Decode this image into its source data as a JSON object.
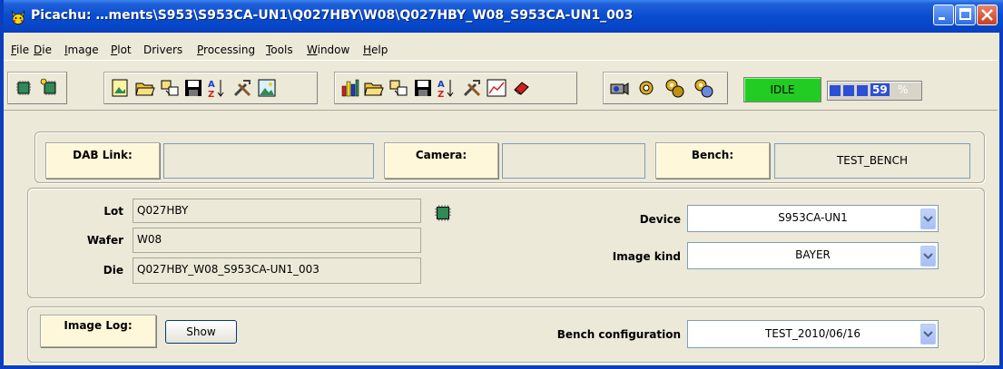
{
  "window": {
    "title": "Picachu: …ments\\S953\\S953CA-UN1\\Q027HBY\\W08\\Q027HBY_W08_S953CA-UN1_003",
    "icon": "pikachu-icon",
    "title_color": "#0A4CD0"
  },
  "menu": {
    "items": [
      {
        "accel": "F",
        "rest": "ile"
      },
      {
        "accel": "D",
        "rest": "ie"
      },
      {
        "accel": "I",
        "rest": "mage"
      },
      {
        "accel": "P",
        "rest": "lot"
      },
      {
        "accel": "D",
        "rest": "rivers",
        "prefix": ""
      },
      {
        "accel": "P",
        "rest": "rocessing"
      },
      {
        "accel": "T",
        "rest": "ools"
      },
      {
        "accel": "W",
        "rest": "indow"
      },
      {
        "accel": "H",
        "rest": "elp"
      }
    ]
  },
  "toolbar": {
    "icons": [
      "chip-icon",
      "chip-load-icon",
      "new-image-icon",
      "open-folder-icon",
      "export-icon",
      "save-icon",
      "sort-icon",
      "tools-icon",
      "image-view-icon",
      "plot-icon",
      "open-folder-icon",
      "export-icon",
      "save-icon",
      "sort-icon",
      "tools-icon",
      "line-chart-icon",
      "eraser-icon",
      "camera-icon",
      "gear-icon",
      "gears-icon",
      "gears-blue-icon"
    ]
  },
  "status": {
    "state": "IDLE",
    "state_color": "#22CC22",
    "progress_value": "59",
    "progress_unit": "%",
    "progress_fraction": 0.59
  },
  "connections": {
    "dab_label": "DAB Link:",
    "dab_value": "",
    "camera_label": "Camera:",
    "camera_value": "",
    "bench_label": "Bench:",
    "bench_value": "TEST_BENCH"
  },
  "lot_info": {
    "lot_label": "Lot",
    "lot_value": "Q027HBY",
    "wafer_label": "Wafer",
    "wafer_value": "W08",
    "die_label": "Die",
    "die_value": "Q027HBY_W08_S953CA-UN1_003"
  },
  "selectors": {
    "device_label": "Device",
    "device_value": "S953CA-UN1",
    "image_kind_label": "Image kind",
    "image_kind_value": "BAYER",
    "bench_config_label": "Bench configuration",
    "bench_config_value": "TEST_2010/06/16"
  },
  "image_log": {
    "label": "Image Log:",
    "show_button": "Show"
  }
}
